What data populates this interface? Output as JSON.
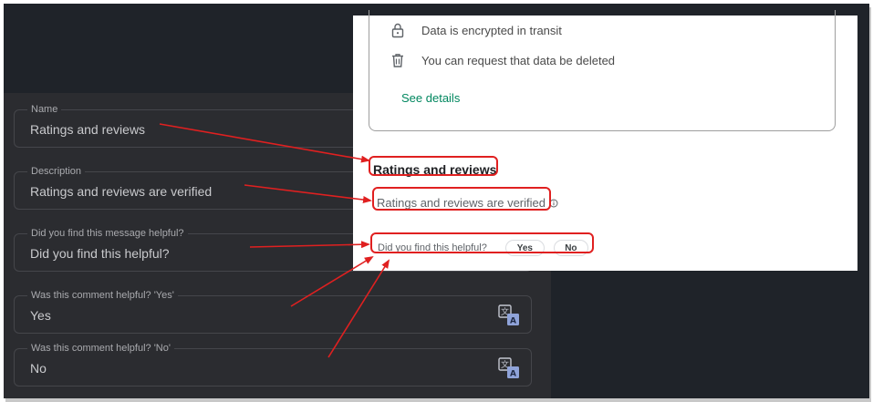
{
  "form": {
    "fields": [
      {
        "label": "Name",
        "value": "Ratings and reviews",
        "translatable": false
      },
      {
        "label": "Description",
        "value": "Ratings and reviews are verified",
        "translatable": false
      },
      {
        "label": "Did you find this message helpful?",
        "value": "Did you find this helpful?",
        "translatable": false
      },
      {
        "label": "Was this comment helpful? 'Yes'",
        "value": "Yes",
        "translatable": true,
        "icon": "translate-icon"
      },
      {
        "label": "Was this comment helpful? 'No'",
        "value": "No",
        "translatable": true,
        "icon": "translate-icon"
      }
    ]
  },
  "preview": {
    "data_safety": {
      "items": [
        {
          "icon": "lock-icon",
          "text": "Data is encrypted in transit"
        },
        {
          "icon": "trash-icon",
          "text": "You can request that data be deleted"
        }
      ],
      "link": "See details"
    },
    "ratings": {
      "heading": "Ratings and reviews",
      "subheading": "Ratings and reviews are verified",
      "info_icon": "info-icon"
    },
    "helpful": {
      "question": "Did you find this helpful?",
      "yes": "Yes",
      "no": "No"
    }
  },
  "colors": {
    "dark_background": "#1f2329",
    "panel_background": "#2b2c30",
    "annotation_red": "#e02020",
    "link_green": "#01875f"
  }
}
